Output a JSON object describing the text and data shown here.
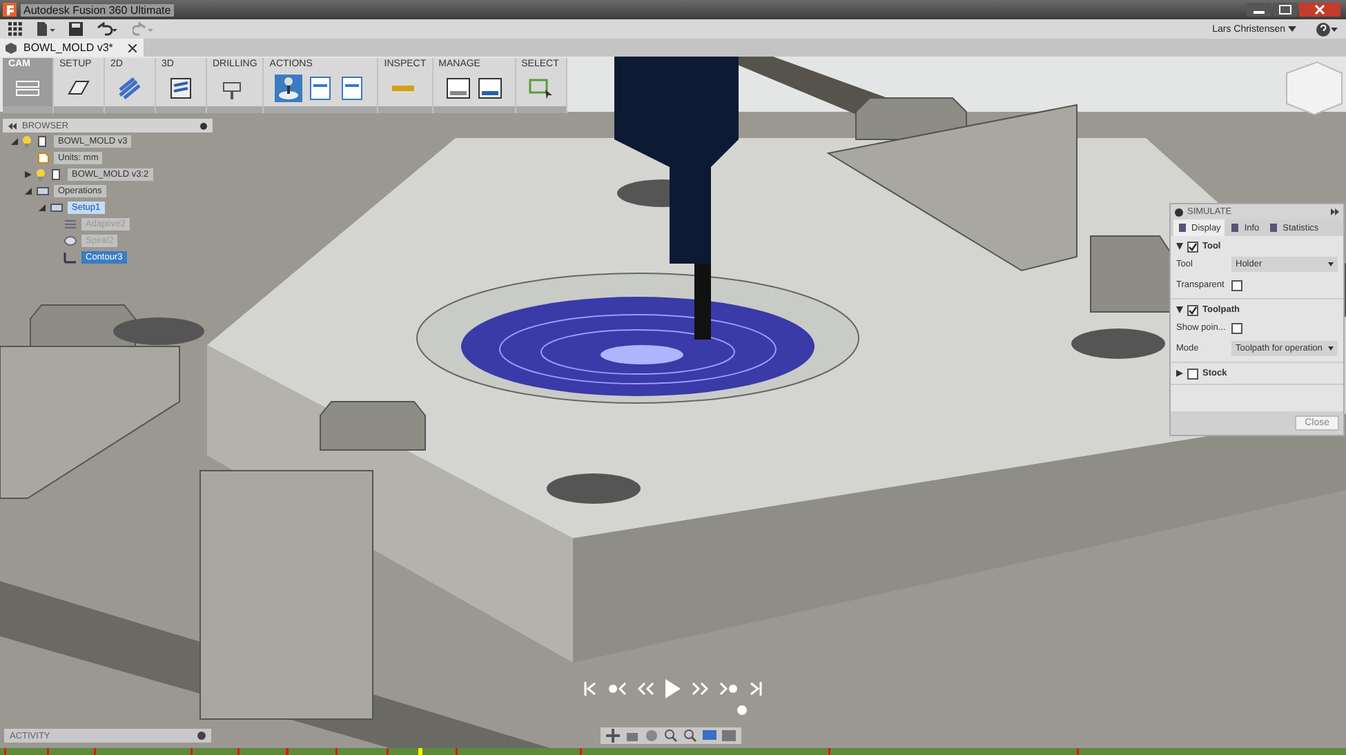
{
  "window": {
    "title": "Autodesk Fusion 360 Ultimate"
  },
  "user": {
    "name": "Lars Christensen"
  },
  "document_tab": {
    "title": "BOWL_MOLD v3*"
  },
  "toolbar": {
    "groups": [
      {
        "label": "CAM",
        "selected": true,
        "tools": [
          {
            "kind": "workspace",
            "selected": false
          }
        ]
      },
      {
        "label": "SETUP",
        "selected": false,
        "tools": [
          {
            "kind": "setup",
            "selected": false
          }
        ]
      },
      {
        "label": "2D",
        "selected": false,
        "tools": [
          {
            "kind": "twod",
            "selected": false
          }
        ]
      },
      {
        "label": "3D",
        "selected": false,
        "tools": [
          {
            "kind": "threed",
            "selected": false
          }
        ]
      },
      {
        "label": "DRILLING",
        "selected": false,
        "tools": [
          {
            "kind": "drill",
            "selected": false
          }
        ]
      },
      {
        "label": "ACTIONS",
        "selected": false,
        "tools": [
          {
            "kind": "simulate",
            "selected": true
          },
          {
            "kind": "post",
            "selected": false
          },
          {
            "kind": "sheet",
            "selected": false
          }
        ]
      },
      {
        "label": "INSPECT",
        "selected": false,
        "tools": [
          {
            "kind": "measure",
            "selected": false
          }
        ]
      },
      {
        "label": "MANAGE",
        "selected": false,
        "tools": [
          {
            "kind": "library",
            "selected": false
          },
          {
            "kind": "postlib",
            "selected": false
          }
        ]
      },
      {
        "label": "SELECT",
        "selected": false,
        "tools": [
          {
            "kind": "select",
            "selected": false
          }
        ]
      }
    ]
  },
  "browser": {
    "title": "BROWSER",
    "items": [
      {
        "label": "BOWL_MOLD v3",
        "kind": "component",
        "expanded": true,
        "visible": true,
        "children": [
          {
            "label": "Units: mm",
            "kind": "units"
          },
          {
            "label": "BOWL_MOLD v3:2",
            "kind": "component",
            "expanded": false,
            "visible": true
          },
          {
            "label": "Operations",
            "kind": "operations",
            "expanded": true,
            "children": [
              {
                "label": "Setup1",
                "kind": "setup",
                "expanded": true,
                "active": true,
                "children": [
                  {
                    "label": "Adaptive2",
                    "kind": "adaptive",
                    "dimmed": true,
                    "selected": false
                  },
                  {
                    "label": "Spiral2",
                    "kind": "spiral",
                    "dimmed": true,
                    "selected": false
                  },
                  {
                    "label": "Contour3",
                    "kind": "contour",
                    "dimmed": false,
                    "selected": true
                  }
                ]
              }
            ]
          }
        ]
      }
    ]
  },
  "simulate": {
    "title": "SIMULATE",
    "tabs": [
      {
        "label": "Display",
        "selected": true
      },
      {
        "label": "Info",
        "selected": false
      },
      {
        "label": "Statistics",
        "selected": false
      }
    ],
    "sections": [
      {
        "label": "Tool",
        "expanded": true,
        "checked": true,
        "rows": [
          {
            "kind": "dropdown",
            "label": "Tool",
            "value": "Holder"
          },
          {
            "kind": "checkbox",
            "label": "Transparent",
            "checked": false
          }
        ]
      },
      {
        "label": "Toolpath",
        "expanded": true,
        "checked": true,
        "rows": [
          {
            "kind": "checkbox",
            "label": "Show poin...",
            "checked": false
          },
          {
            "kind": "dropdown",
            "label": "Mode",
            "value": "Toolpath for operation"
          }
        ]
      },
      {
        "label": "Stock",
        "expanded": false,
        "checked": false
      }
    ],
    "close_button": "Close"
  },
  "playback": {
    "level": 0.84
  },
  "activity": {
    "title": "ACTIVITY"
  }
}
